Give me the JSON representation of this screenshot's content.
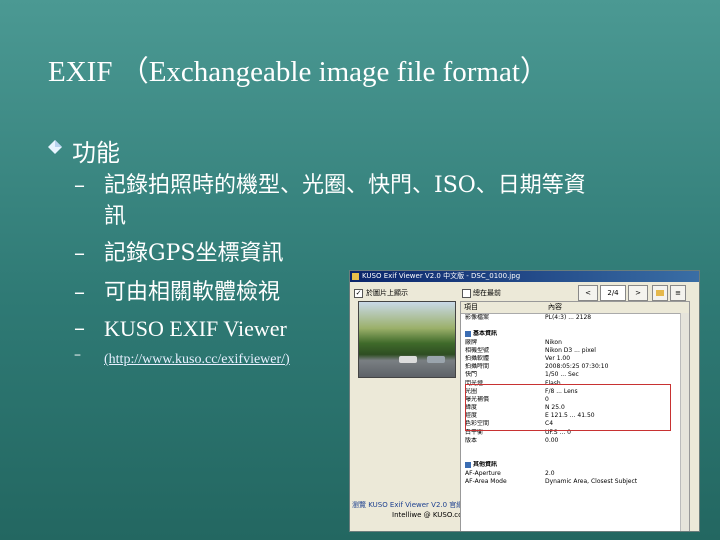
{
  "slide": {
    "title": "EXIF （Exchangeable image file format）",
    "bullet": "功能",
    "items": [
      "記錄拍照時的機型、光圈、快門、ISO、日期等資",
      "訊",
      "記錄GPS坐標資訊",
      "可由相關軟體檢視",
      "KUSO EXIF Viewer"
    ],
    "dashes": [
      "–",
      "–",
      "–",
      "–",
      "–"
    ],
    "link_text": "(http://www.kuso.cc/exifviewer/)"
  },
  "window": {
    "title": "KUSO Exif Viewer V2.0 中文版 - DSC_0100.jpg",
    "checkbox_label": "於圖片上顯示",
    "right_check": "總在最前",
    "nav_prev": "<",
    "nav_next": ">",
    "page": "2/4",
    "logo_line1": "瀏覽 KUSO Exif Viewer V2.0 官網",
    "logo_line2": "Intelliwe @ KUSO.cc",
    "columns": [
      "項目",
      "內容"
    ],
    "rows": [
      {
        "k": "影像檔案",
        "v": "PL(4:3) ... 2128"
      },
      {
        "k": "",
        "v": ""
      },
      {
        "k": "基本資訊",
        "v": "",
        "group": true
      },
      {
        "k": "廠牌",
        "v": "Nikon"
      },
      {
        "k": "相機型號",
        "v": "Nikon D3 ... pixel"
      },
      {
        "k": "拍攝軟體",
        "v": "Ver 1.00"
      },
      {
        "k": "拍攝時間",
        "v": "2008:05:25 07:30:10"
      },
      {
        "k": "快門",
        "v": "1/50 ... Sec"
      },
      {
        "k": "閃光燈",
        "v": "Flash"
      },
      {
        "k": "光圈",
        "v": "F/8 ... Lens"
      },
      {
        "k": "曝光補償",
        "v": "0"
      },
      {
        "k": "緯度",
        "v": "N 25.0"
      },
      {
        "k": "經度",
        "v": "E 121.5 ... 41.50"
      },
      {
        "k": "色彩空間",
        "v": "C4"
      },
      {
        "k": "白平衡",
        "v": "UF.S ... 0"
      },
      {
        "k": "版本",
        "v": "0.00"
      },
      {
        "k": "",
        "v": ""
      },
      {
        "k": "",
        "v": ""
      },
      {
        "k": "其他資訊",
        "v": "",
        "group": true
      },
      {
        "k": "AF-Aperture",
        "v": "2.0"
      },
      {
        "k": "AF-Area Mode",
        "v": "Dynamic Area, Closest Subject"
      }
    ]
  }
}
